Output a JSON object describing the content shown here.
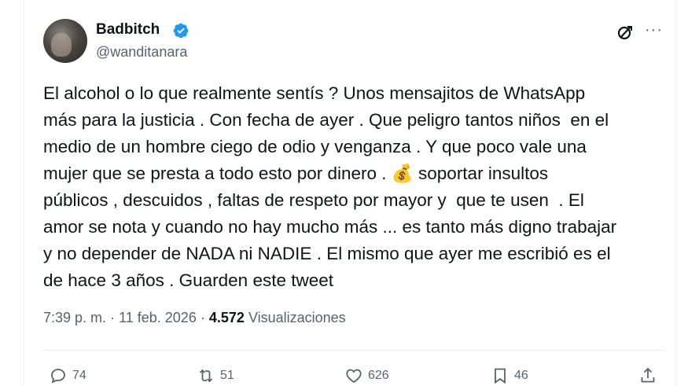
{
  "author": {
    "display_name": "Badbitch",
    "handle": "@wanditanara",
    "verified_color": "#1d9bf0"
  },
  "tweet": {
    "text": "El alcohol o lo que realmente sentís ? Unos mensajitos de WhatsApp\nmás para la justicia . Con fecha de ayer . Que peligro tantos niños  en el\nmedio de un hombre ciego de odio y venganza . Y que poco vale una\nmujer que se presta a todo esto por dinero . 💰 soportar insultos\npúblicos , descuidos , faltas de respeto por mayor y  que te usen  . El\namor se nota y cuando no hay mucho más ... es tanto más digno trabajar\ny no depender de NADA ni NADIE . El mismo que ayer me escribió es el\nde hace 3 años . Guarden este tweet"
  },
  "meta": {
    "time": "7:39 p. m.",
    "separator": "·",
    "date": "11 feb. 2026",
    "views_count": "4.572",
    "views_label": "Visualizaciones"
  },
  "actions": {
    "replies": "74",
    "retweets": "51",
    "likes": "626",
    "bookmarks": "46"
  },
  "icons": {
    "header": [
      "grok-icon",
      "more-icon"
    ],
    "actions": [
      "reply-icon",
      "retweet-icon",
      "like-icon",
      "bookmark-icon",
      "share-icon"
    ]
  }
}
